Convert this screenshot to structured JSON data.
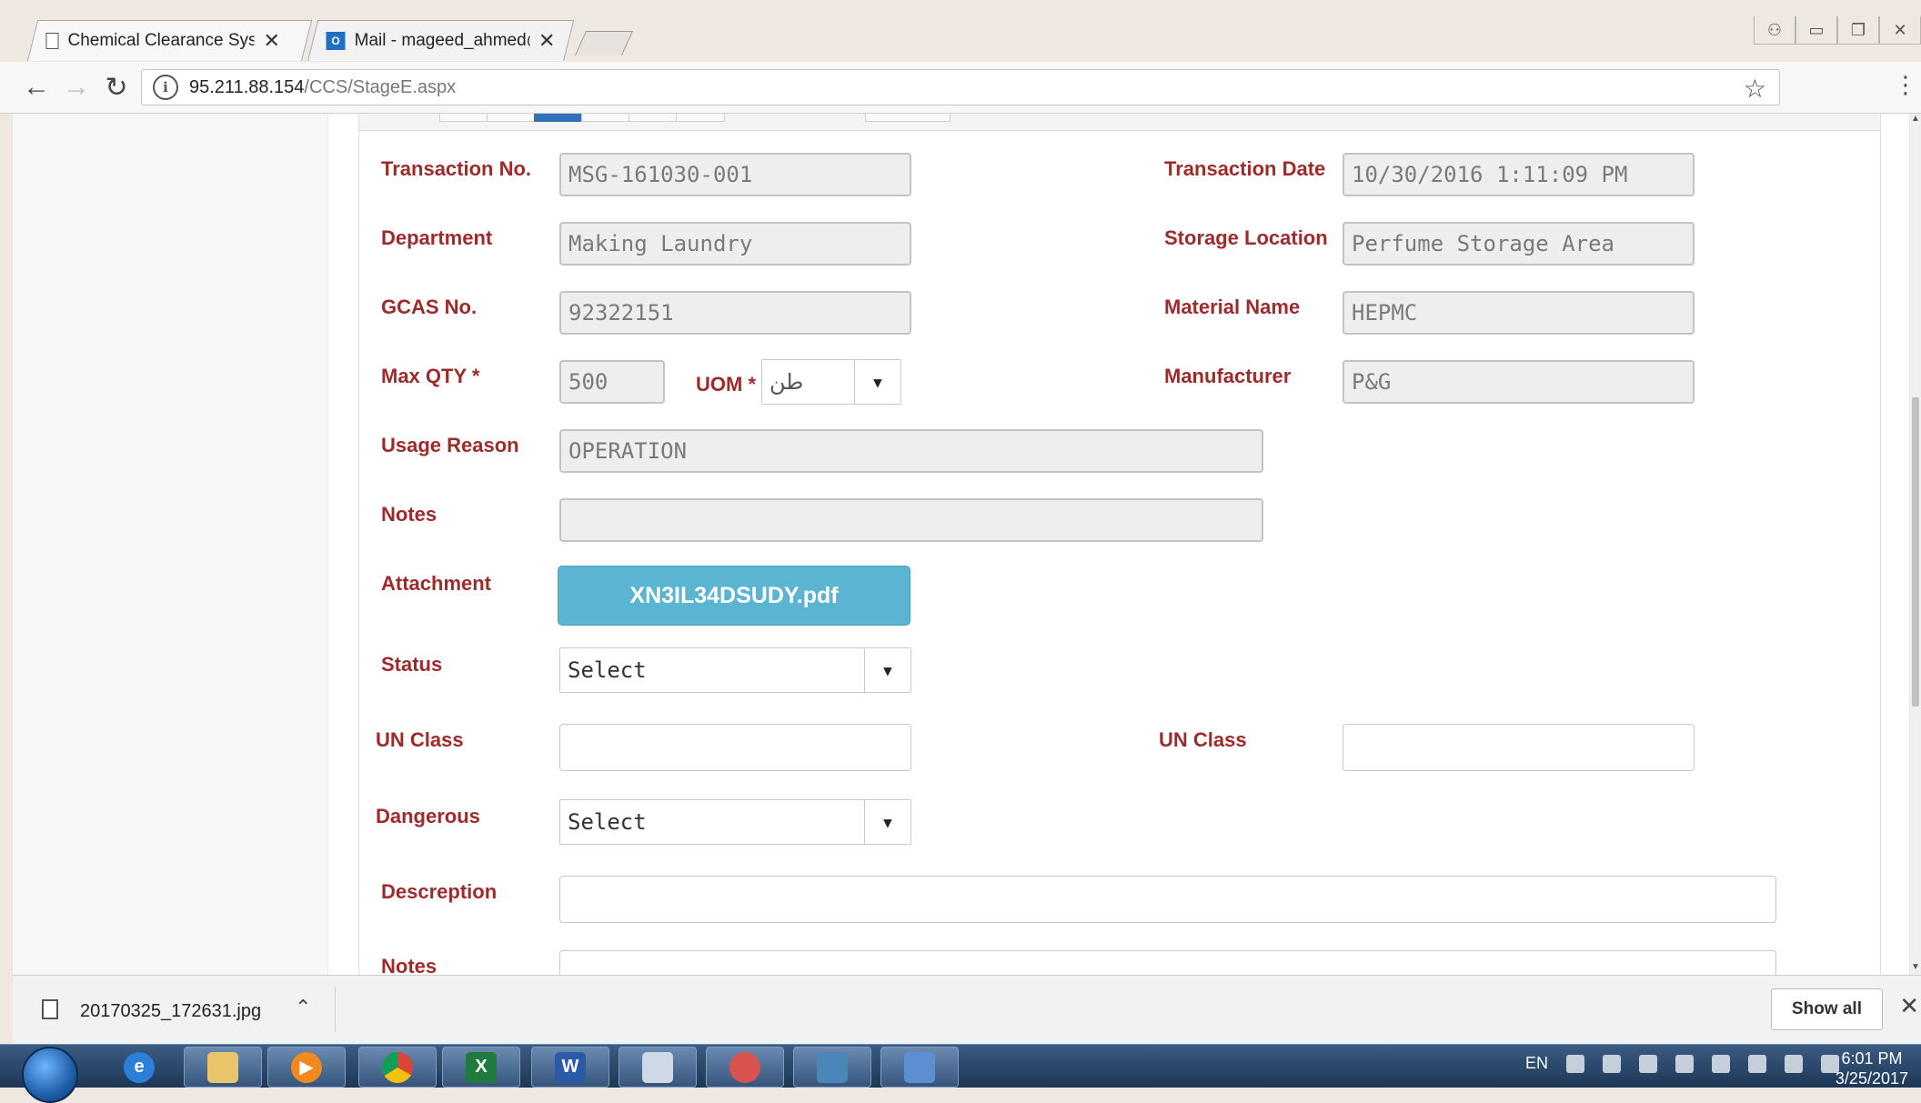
{
  "browser": {
    "tabs": [
      {
        "title": "Chemical Clearance Syste",
        "icon": "page-icon",
        "active": true
      },
      {
        "title": "Mail - mageed_ahmed@",
        "icon": "outlook-icon",
        "active": false
      }
    ],
    "url_host": "95.211.88.154",
    "url_path": "/CCS/StageE.aspx"
  },
  "form": {
    "transaction_no": {
      "label": "Transaction No.",
      "value": "MSG-161030-001"
    },
    "transaction_date": {
      "label": "Transaction Date",
      "value": "10/30/2016 1:11:09 PM"
    },
    "department": {
      "label": "Department",
      "value": "Making Laundry"
    },
    "storage_location": {
      "label": "Storage Location",
      "value": "Perfume Storage Area"
    },
    "gcas_no": {
      "label": "GCAS No.",
      "value": "92322151"
    },
    "material_name": {
      "label": "Material Name",
      "value": "HEPMC"
    },
    "max_qty": {
      "label": "Max QTY *",
      "value": "500"
    },
    "uom": {
      "label": "UOM *",
      "value": "طن"
    },
    "manufacturer": {
      "label": "Manufacturer",
      "value": "P&G"
    },
    "usage_reason": {
      "label": "Usage Reason",
      "value": "OPERATION"
    },
    "notes": {
      "label": "Notes",
      "value": ""
    },
    "attachment": {
      "label": "Attachment",
      "file": "XN3IL34DSUDY.pdf"
    },
    "status": {
      "label": "Status",
      "value": "Select"
    },
    "un_class_left": {
      "label": "UN Class",
      "value": ""
    },
    "un_class_right": {
      "label": "UN Class",
      "value": ""
    },
    "dangerous": {
      "label": "Dangerous",
      "value": "Select"
    },
    "description": {
      "label": "Descreption",
      "value": ""
    },
    "notes2": {
      "label": "Notes"
    }
  },
  "downloads": {
    "file": "20170325_172631.jpg",
    "show_all": "Show all"
  },
  "taskbar": {
    "language": "EN",
    "time": "6:01 PM",
    "date": "3/25/2017"
  },
  "colors": {
    "label": "#9e2b2b",
    "attachment_button": "#5bb4d2",
    "active_step": "#3370b7"
  }
}
